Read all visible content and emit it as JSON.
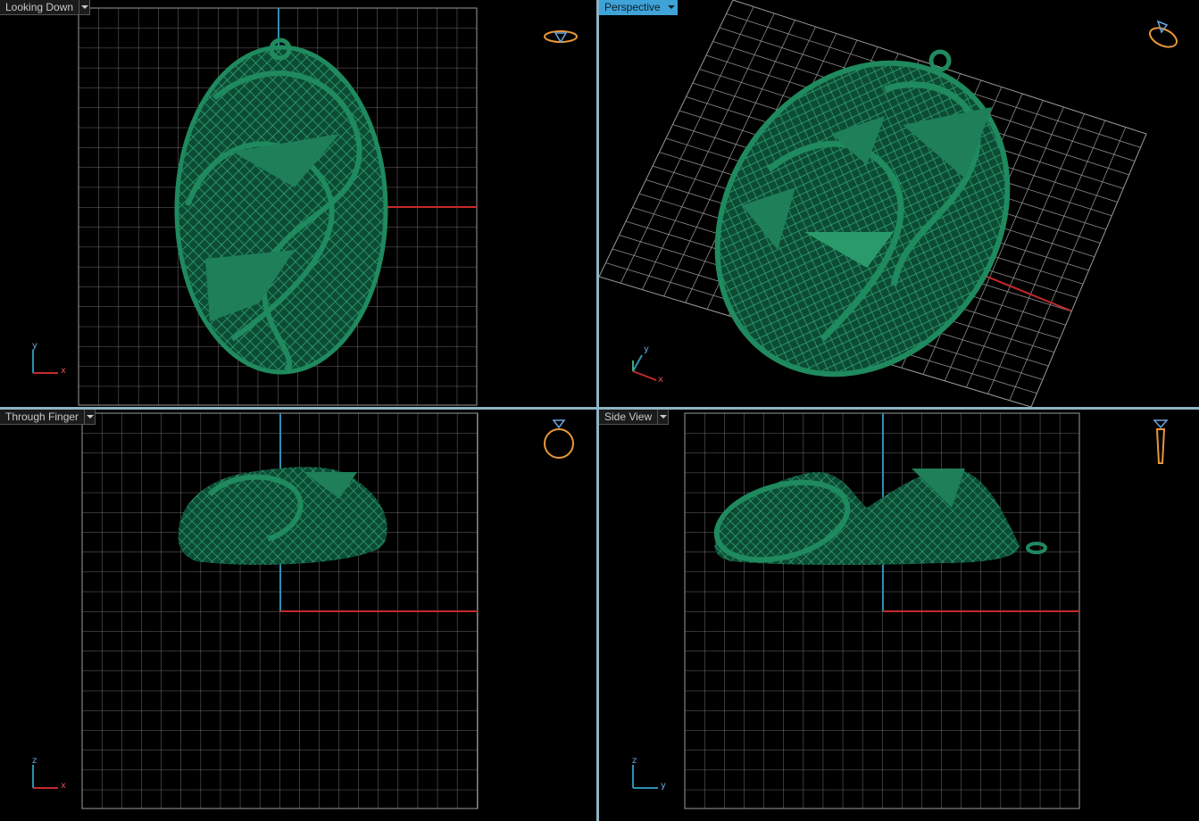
{
  "viewports": {
    "top_left": {
      "title": "Looking Down",
      "axis_labels": {
        "h": "x",
        "v": "y"
      },
      "icon": "looking-down-ring-icon",
      "active": false
    },
    "top_right": {
      "title": "Perspective",
      "axis_labels": {
        "h": "x",
        "v": "y"
      },
      "icon": "perspective-ring-icon",
      "active": true
    },
    "bottom_left": {
      "title": "Through Finger",
      "axis_labels": {
        "h": "x",
        "v": "z"
      },
      "icon": "through-finger-ring-icon",
      "active": false
    },
    "bottom_right": {
      "title": "Side View",
      "axis_labels": {
        "h": "y",
        "v": "z"
      },
      "icon": "side-view-ring-icon",
      "active": false
    }
  },
  "colors": {
    "background": "#000000",
    "grid": "#9a9a9a",
    "axis_red": "#c42a2a",
    "axis_blue": "#2f8fb0",
    "model_green": "#1c7a55",
    "active_tab": "#3fa3d8",
    "icon_orange": "#e8973a"
  }
}
